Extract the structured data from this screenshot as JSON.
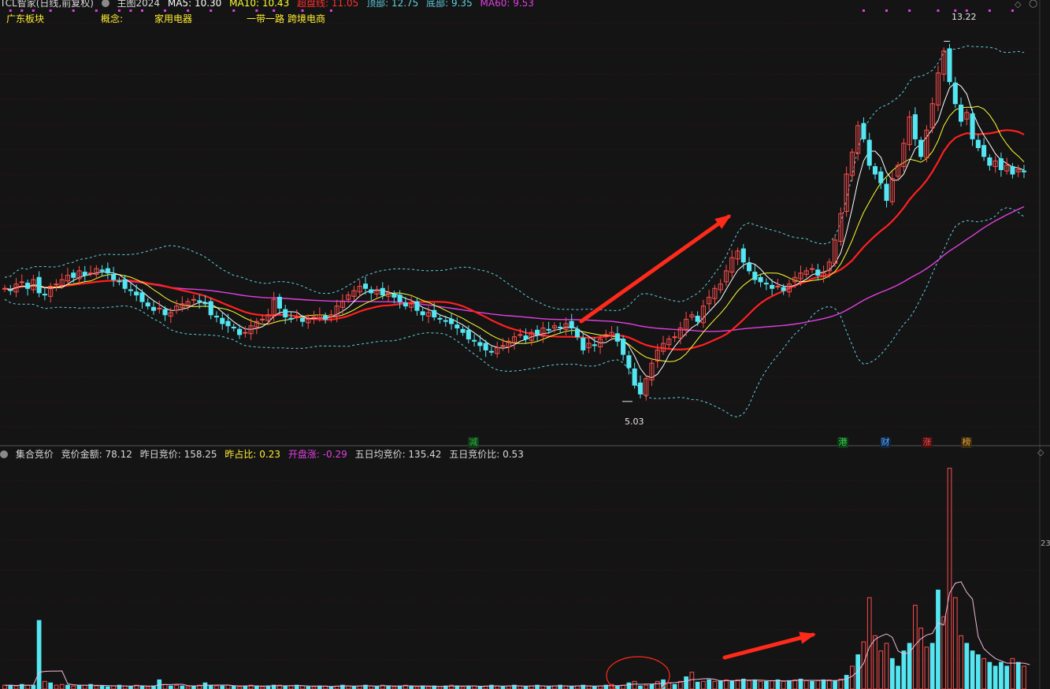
{
  "main_header": {
    "title": "TCL智家(日线,前复权)",
    "indicator": "主图2024",
    "ma5": "MA5: 10.30",
    "ma10": "MA10: 10.43",
    "overbought": "超盘线: 11.05",
    "top": "顶部: 12.75",
    "bottom": "底部: 9.35",
    "ma60": "MA60: 9.53"
  },
  "tags_row": {
    "sector": "广东板块",
    "concept_label": "概念:",
    "concept1": "家用电器",
    "concept2": "一带一路",
    "concept3": "跨境电商"
  },
  "sub_header": {
    "title": "集合竞价",
    "amount": "竞价金额: 78.12",
    "prev_amount": "昨日竞价: 158.25",
    "ratio": "昨占比: 0.23",
    "open_change": "开盘涨: -0.29",
    "avg5": "五日均竞价: 135.42",
    "ratio5": "五日竞价比: 0.53"
  },
  "event_markers": [
    {
      "label": "减",
      "color": "#2fae3c",
      "bg": "#0f3a18"
    },
    {
      "label": "港",
      "color": "#3ccf4e",
      "bg": "#0f3a18"
    },
    {
      "label": "财",
      "color": "#5aa8ff",
      "bg": "#10253d"
    },
    {
      "label": "涨",
      "color": "#ff4a4a",
      "bg": "#3d1010"
    },
    {
      "label": "榜",
      "color": "#e0a040",
      "bg": "#3a2a10"
    }
  ],
  "colors": {
    "bg": "#141414",
    "grid": "#3a1212",
    "up": "#ff4d4d",
    "down": "#54e6f2",
    "ma5": "#ffffff",
    "ma10": "#ffff33",
    "ma20": "#ff2020",
    "ma60": "#e040e0",
    "band": "#5fd0e0",
    "arrow": "#ff2a1a",
    "highlight": "#ffee00"
  },
  "chart_data": [
    {
      "type": "candlestick",
      "ylim": [
        4.4,
        13.8
      ],
      "annotations": [
        {
          "text": "13.22",
          "value": 13.22
        },
        {
          "text": "5.03",
          "value": 5.03
        }
      ],
      "closes": [
        7.6,
        7.55,
        7.7,
        7.75,
        7.6,
        7.8,
        7.5,
        7.45,
        7.65,
        7.7,
        7.8,
        7.9,
        7.85,
        8.0,
        7.9,
        7.95,
        8.05,
        8.0,
        7.95,
        7.8,
        7.75,
        7.6,
        7.55,
        7.45,
        7.3,
        7.2,
        7.1,
        7.15,
        7.0,
        7.05,
        7.2,
        7.25,
        7.3,
        7.35,
        7.3,
        7.25,
        7.0,
        6.95,
        6.8,
        6.75,
        6.7,
        6.55,
        6.6,
        6.75,
        6.85,
        6.9,
        7.0,
        7.35,
        7.15,
        6.95,
        6.9,
        6.95,
        6.85,
        6.9,
        6.95,
        7.0,
        6.9,
        7.0,
        7.2,
        7.3,
        7.45,
        7.55,
        7.65,
        7.6,
        7.5,
        7.55,
        7.45,
        7.5,
        7.4,
        7.3,
        7.2,
        7.25,
        7.1,
        7.0,
        7.05,
        6.95,
        6.9,
        6.85,
        6.8,
        6.7,
        6.6,
        6.45,
        6.4,
        6.3,
        6.2,
        6.15,
        6.25,
        6.3,
        6.4,
        6.5,
        6.55,
        6.45,
        6.6,
        6.55,
        6.7,
        6.65,
        6.75,
        6.7,
        6.8,
        6.7,
        6.5,
        6.2,
        6.35,
        6.3,
        6.45,
        6.55,
        6.6,
        6.4,
        6.1,
        5.8,
        5.4,
        5.2,
        5.55,
        5.9,
        6.2,
        6.35,
        6.45,
        6.5,
        6.7,
        6.9,
        7.0,
        6.85,
        7.2,
        7.4,
        7.6,
        7.7,
        8.0,
        8.3,
        8.45,
        8.2,
        8.0,
        7.8,
        7.75,
        7.7,
        7.6,
        7.65,
        7.55,
        7.7,
        7.85,
        7.95,
        8.0,
        8.05,
        7.9,
        7.95,
        8.2,
        8.7,
        9.3,
        10.2,
        10.7,
        11.3,
        11.0,
        10.4,
        10.2,
        10.0,
        9.6,
        10.1,
        10.4,
        10.9,
        11.5,
        11.0,
        10.6,
        11.2,
        11.8,
        12.5,
        13.0,
        12.3,
        11.8,
        11.4,
        11.6,
        11.0,
        10.8,
        10.6,
        10.4,
        10.5,
        10.3,
        10.4,
        10.2,
        10.3,
        10.25
      ],
      "volumes_mid": [
        0.4,
        0.35,
        0.3,
        0.4,
        0.3,
        0.35,
        0.3,
        0.25,
        0.3,
        0.3,
        0.5,
        0.3,
        0.3,
        0.3,
        0.3,
        0.3,
        0.25,
        0.2,
        0.2,
        0.3,
        0.3,
        0.3,
        0.3,
        0.25,
        0.2,
        0.25,
        0.2,
        0.25,
        0.2,
        0.3,
        0.25,
        0.2,
        0.2,
        0.2,
        0.2,
        0.2,
        0.2,
        0.2,
        0.2,
        0.2,
        0.2,
        0.2,
        0.2,
        0.2,
        0.2,
        0.2,
        0.2,
        0.2,
        0.2,
        0.2,
        0.2,
        0.2,
        0.2,
        0.2,
        0.2,
        0.2,
        0.2,
        0.2,
        0.2,
        0.2,
        0.2,
        0.2,
        0.2,
        0.2,
        0.2,
        0.2,
        0.2,
        0.2,
        0.2,
        0.2,
        0.2,
        0.2,
        0.2,
        0.2,
        0.2,
        0.2,
        0.2,
        0.2,
        0.2,
        0.2,
        0.2,
        0.2,
        0.2,
        0.2,
        0.2,
        0.2,
        0.2,
        0.2,
        0.2,
        0.2,
        0.2,
        0.2,
        0.2,
        0.2,
        0.2,
        0.2,
        0.2,
        0.2,
        0.2,
        0.2,
        0.2,
        0.2,
        0.2,
        0.2,
        0.2,
        0.2,
        0.2,
        0.2,
        0.2,
        0.2,
        0.2,
        0.2,
        0.2,
        0.2,
        0.2,
        0.2,
        0.2,
        0.2,
        0.2,
        0.2,
        0.2,
        0.2,
        0.2,
        0.2,
        0.2,
        0.2,
        0.2,
        0.2,
        0.2,
        0.2,
        0.2,
        0.2,
        0.2,
        0.2,
        0.2,
        0.2,
        0.2,
        0.2,
        0.2,
        0.2,
        0.2,
        0.2,
        0.2,
        0.2,
        0.2,
        0.2,
        0.2,
        0.2,
        0.2,
        0.2,
        0.2,
        0.2,
        0.2,
        0.2,
        0.2,
        0.2,
        0.2,
        0.2,
        0.2,
        0.2,
        0.2,
        0.2,
        0.2,
        0.2,
        0.2,
        0.2,
        0.2,
        0.2,
        0.2,
        0.2,
        0.2,
        0.2,
        0.2,
        0.2,
        0.2,
        0.2,
        0.2,
        0.2,
        0.2,
        0.2,
        0.2,
        0.2,
        0.2
      ]
    },
    {
      "type": "bar",
      "right_label": "23",
      "ylim": [
        0,
        3.0
      ],
      "volumes": [
        0.05,
        0.05,
        0.04,
        0.06,
        0.05,
        0.05,
        0.9,
        0.1,
        0.08,
        0.05,
        0.06,
        0.05,
        0.04,
        0.05,
        0.05,
        0.06,
        0.04,
        0.04,
        0.03,
        0.04,
        0.05,
        0.04,
        0.03,
        0.05,
        0.04,
        0.03,
        0.04,
        0.12,
        0.06,
        0.04,
        0.05,
        0.04,
        0.03,
        0.04,
        0.05,
        0.08,
        0.05,
        0.04,
        0.04,
        0.05,
        0.04,
        0.03,
        0.04,
        0.05,
        0.04,
        0.03,
        0.04,
        0.05,
        0.05,
        0.04,
        0.04,
        0.05,
        0.04,
        0.03,
        0.03,
        0.04,
        0.04,
        0.03,
        0.04,
        0.05,
        0.04,
        0.03,
        0.04,
        0.05,
        0.04,
        0.03,
        0.05,
        0.04,
        0.03,
        0.04,
        0.05,
        0.04,
        0.03,
        0.04,
        0.03,
        0.04,
        0.03,
        0.04,
        0.05,
        0.04,
        0.03,
        0.04,
        0.04,
        0.03,
        0.04,
        0.05,
        0.04,
        0.03,
        0.04,
        0.05,
        0.04,
        0.03,
        0.04,
        0.05,
        0.04,
        0.03,
        0.04,
        0.05,
        0.04,
        0.03,
        0.04,
        0.05,
        0.04,
        0.03,
        0.04,
        0.05,
        0.06,
        0.04,
        0.05,
        0.08,
        0.1,
        0.04,
        0.05,
        0.06,
        0.1,
        0.12,
        0.08,
        0.06,
        0.1,
        0.16,
        0.22,
        0.09,
        0.1,
        0.12,
        0.1,
        0.11,
        0.12,
        0.1,
        0.12,
        0.13,
        0.11,
        0.12,
        0.1,
        0.1,
        0.11,
        0.12,
        0.1,
        0.11,
        0.12,
        0.13,
        0.11,
        0.1,
        0.11,
        0.12,
        0.12,
        0.11,
        0.13,
        0.18,
        0.3,
        0.45,
        0.62,
        1.2,
        0.7,
        0.5,
        0.6,
        0.4,
        0.3,
        0.5,
        0.6,
        1.1,
        0.8,
        0.55,
        0.6,
        1.3,
        0.95,
        2.9,
        1.2,
        0.7,
        0.6,
        0.5,
        0.45,
        0.4,
        0.35,
        0.3,
        0.35,
        0.3,
        0.4,
        0.35,
        0.3,
        0.25
      ],
      "up_flags": [
        1,
        0,
        1,
        0,
        1,
        0,
        0,
        1,
        0,
        1,
        1,
        0,
        1,
        0,
        1,
        0,
        1,
        0,
        0,
        1,
        0,
        1,
        0,
        1,
        0,
        1,
        0,
        0,
        1,
        0,
        1,
        0,
        1,
        0,
        1,
        0,
        0,
        1,
        0,
        1,
        0,
        1,
        0,
        1,
        0,
        1,
        0,
        0,
        1,
        0,
        1,
        0,
        1,
        0,
        1,
        0,
        1,
        0,
        1,
        0,
        1,
        0,
        1,
        0,
        1,
        0,
        1,
        0,
        1,
        0,
        1,
        0,
        1,
        0,
        1,
        0,
        1,
        0,
        1,
        0,
        1,
        0,
        1,
        0,
        1,
        0,
        1,
        0,
        1,
        0,
        1,
        0,
        1,
        0,
        1,
        0,
        1,
        0,
        1,
        0,
        1,
        0,
        1,
        0,
        1,
        0,
        1,
        0,
        1,
        0,
        1,
        0,
        1,
        0,
        1,
        0,
        1,
        0,
        1,
        0,
        1,
        0,
        1,
        0,
        1,
        0,
        1,
        0,
        1,
        0,
        1,
        0,
        1,
        0,
        1,
        0,
        1,
        0,
        1,
        0,
        1,
        0,
        1,
        0,
        1,
        0,
        1,
        0,
        1,
        0,
        1,
        1,
        1,
        1,
        1,
        0,
        0,
        0,
        0,
        1,
        1,
        1,
        0,
        0,
        1,
        1,
        1,
        1,
        0,
        0,
        0,
        1,
        0,
        0,
        0,
        0,
        1,
        0,
        1,
        0,
        0
      ]
    }
  ]
}
